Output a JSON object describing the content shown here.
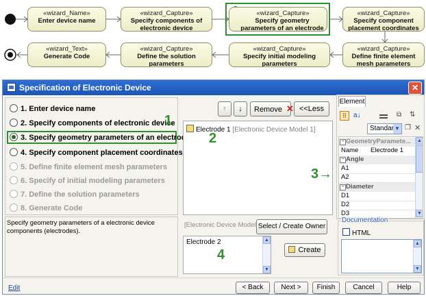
{
  "workflow": {
    "nodes": [
      {
        "stereo": "«wizard_Name»",
        "name": "Enter device name"
      },
      {
        "stereo": "«wizard_Capture»",
        "name": "Specify components of electronic device"
      },
      {
        "stereo": "«wizard_Capture»",
        "name": "Specify geometry parameters of an electrode"
      },
      {
        "stereo": "«wizard_Capture»",
        "name": "Specify component placement coordinates"
      },
      {
        "stereo": "«wizard_Text»",
        "name": "Generate Code"
      },
      {
        "stereo": "«wizard_Capture»",
        "name": "Define the solution parameters"
      },
      {
        "stereo": "«wizard_Capture»",
        "name": "Specify initial modeling parameters"
      },
      {
        "stereo": "«wizard_Capture»",
        "name": "Define finite element mesh parameters"
      }
    ],
    "highlight_number": "1"
  },
  "dialog": {
    "title": "Specification of Electronic Device",
    "steps": [
      {
        "label": "1. Enter device name",
        "state": "enabled"
      },
      {
        "label": "2. Specify components of electronic device",
        "state": "enabled"
      },
      {
        "label": "3. Specify geometry parameters of an electrode",
        "state": "selected"
      },
      {
        "label": "4. Specify component placement coordinates",
        "state": "enabled"
      },
      {
        "label": "5. Define finite element mesh parameters",
        "state": "disabled"
      },
      {
        "label": "6. Specify of initial modeling parameters",
        "state": "disabled"
      },
      {
        "label": "7. Define the solution parameters",
        "state": "disabled"
      },
      {
        "label": "8. Generate Code",
        "state": "disabled"
      }
    ],
    "description": "Specify geometry parameters of a electronic device components (electrodes).",
    "callouts": {
      "c1": "1",
      "c2": "2",
      "c3": "3→",
      "c4": "4"
    },
    "toolbar": {
      "up": "↑",
      "down": "↓",
      "remove": "Remove",
      "less": "<<Less"
    },
    "tree_item": {
      "name": "Electrode 1",
      "context": "[Electronic Device Model 1]"
    },
    "owner_label": "[Electronic Device Model 1]",
    "select_owner": "Select / Create Owner",
    "new_element_value": "Electrode 2",
    "create": "Create",
    "edit_link": "Edit",
    "footer": {
      "back": "< Back",
      "next": "Next >",
      "finish": "Finish",
      "cancel": "Cancel",
      "help": "Help"
    }
  },
  "element_panel": {
    "tab": "Element",
    "sort_az": "a↓",
    "view_mode": "Standard",
    "group_title": "GeometryParamete...",
    "name_key": "Name",
    "name_value": "Electrode 1",
    "groups": [
      {
        "title": "Angle",
        "rows": [
          "A1",
          "A2"
        ]
      },
      {
        "title": "Diameter",
        "rows": [
          "D1",
          "D2",
          "D3"
        ]
      }
    ],
    "documentation_label": "Documentation",
    "html_label": "HTML"
  }
}
